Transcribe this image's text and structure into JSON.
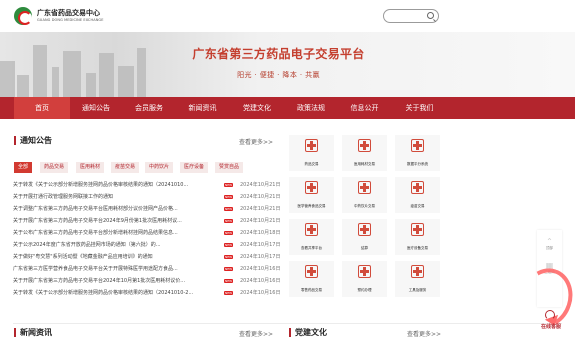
{
  "brand": {
    "name_cn": "广东省药品交易中心",
    "name_en": "GUANG DONG MEDICINE EXCHANGE"
  },
  "banner": {
    "title": "广东省第三方药品电子交易平台",
    "subtitle": "阳光 · 便捷 · 降本 · 共赢"
  },
  "nav": {
    "items": [
      {
        "label": "首页",
        "active": true
      },
      {
        "label": "通知公告"
      },
      {
        "label": "会员服务"
      },
      {
        "label": "新闻资讯"
      },
      {
        "label": "党建文化"
      },
      {
        "label": "政策法规"
      },
      {
        "label": "信息公开"
      },
      {
        "label": "关于我们"
      }
    ]
  },
  "notice": {
    "title": "通知公告",
    "more": "查看更多>>",
    "tabs": [
      "全部",
      "药品交易",
      "医用耗材",
      "疫苗交易",
      "中药饮片",
      "医疗设备",
      "赞赏自品"
    ],
    "items": [
      {
        "title": "关于转发《关于公示部分新增服务挂网药品价格审核结果的通知（20241010...",
        "date": "2024年10月21日"
      },
      {
        "title": "关于开展打通行政管理服务网联接工作的通知",
        "date": "2024年10月21日"
      },
      {
        "title": "关于调整广东省第三方药品电子交易平台医用耗材部分议价挂网产品价格...",
        "date": "2024年10月21日"
      },
      {
        "title": "关于开展广东省第三方药品电子交易平台2024年9月份第1批次医用耗材议...",
        "date": "2024年10月21日"
      },
      {
        "title": "关于公布广东省第三方药品电子交易平台部分新增耗材挂网药品结果信息...",
        "date": "2024年10月18日"
      },
      {
        "title": "关于公示2024年度广东省开放药品挂网市场的通知（第六批）的...",
        "date": "2024年10月17日"
      },
      {
        "title": "关于做好\"粤交慧\"系列活动暨《地藏金融产品应用培训》的通知",
        "date": "2024年10月17日"
      },
      {
        "title": "广东省第三方医学营养食品电子交易平台关于开展特殊医学用途配方食品...",
        "date": "2024年10月16日"
      },
      {
        "title": "关于开展广东省第三方药品电子交易平台2024年10月第1批次医用耗材议价...",
        "date": "2024年10月16日"
      },
      {
        "title": "关于转发《关于公示部分新增服务挂网药品价格审核结果的通知（20241010-2...",
        "date": "2024年10月16日"
      }
    ]
  },
  "services": [
    {
      "label": "药品交易"
    },
    {
      "label": "医用耗材交易"
    },
    {
      "label": "数据平分系统"
    },
    {
      "label": "医学营养食品交易"
    },
    {
      "label": "中药饮片交易"
    },
    {
      "label": "疫苗交易"
    },
    {
      "label": "查看共享平台"
    },
    {
      "label": "结算"
    },
    {
      "label": "医疗设备交易"
    },
    {
      "label": "零售药品交易"
    },
    {
      "label": "预约办理"
    },
    {
      "label": "工具及服务"
    }
  ],
  "news": {
    "title": "新闻资讯",
    "more": "查看更多>>"
  },
  "party": {
    "title": "党建文化",
    "more": "查看更多>>"
  },
  "float": {
    "items": [
      {
        "label": "顶部"
      },
      {
        "label": "二维码"
      }
    ],
    "online_label": "在线客服"
  }
}
